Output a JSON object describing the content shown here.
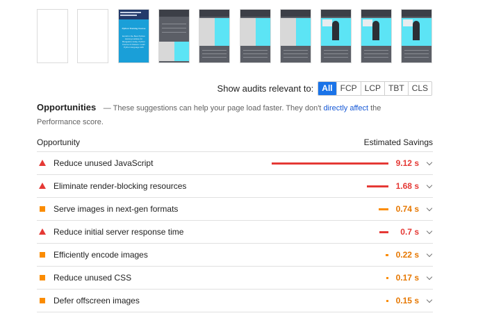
{
  "filter": {
    "label": "Show audits relevant to:",
    "chips": [
      "All",
      "FCP",
      "LCP",
      "TBT",
      "CLS"
    ],
    "active": "All"
  },
  "opportunities": {
    "title": "Opportunities",
    "desc_prefix": "— These suggestions can help your page load faster. They don't",
    "link": "directly affect",
    "desc_suffix": "the",
    "desc_line2": "Performance score."
  },
  "table": {
    "col_left": "Opportunity",
    "col_right": "Estimated Savings",
    "rows": [
      {
        "label": "Reduce unused JavaScript",
        "value": "9.12 s",
        "severity": "fail",
        "fraction": 1.0
      },
      {
        "label": "Eliminate render-blocking resources",
        "value": "1.68 s",
        "severity": "fail",
        "fraction": 0.184
      },
      {
        "label": "Serve images in next-gen formats",
        "value": "0.74 s",
        "severity": "average",
        "fraction": 0.081
      },
      {
        "label": "Reduce initial server response time",
        "value": "0.7 s",
        "severity": "fail",
        "fraction": 0.077
      },
      {
        "label": "Efficiently encode images",
        "value": "0.22 s",
        "severity": "average",
        "fraction": 0.024
      },
      {
        "label": "Reduce unused CSS",
        "value": "0.17 s",
        "severity": "average",
        "fraction": 0.019
      },
      {
        "label": "Defer offscreen images",
        "value": "0.15 s",
        "severity": "average",
        "fraction": 0.016
      }
    ]
  },
  "filmstrip_text": {
    "blue_frame_heading": "Python Training Course",
    "blue_frame_body": "Enroll in the Best Python training institute for Bangalore today. Python Course & Classes. Learn Python language with"
  },
  "colors": {
    "fail": "#e53935",
    "average": "#fb8c00",
    "accent": "#1a73e8"
  }
}
